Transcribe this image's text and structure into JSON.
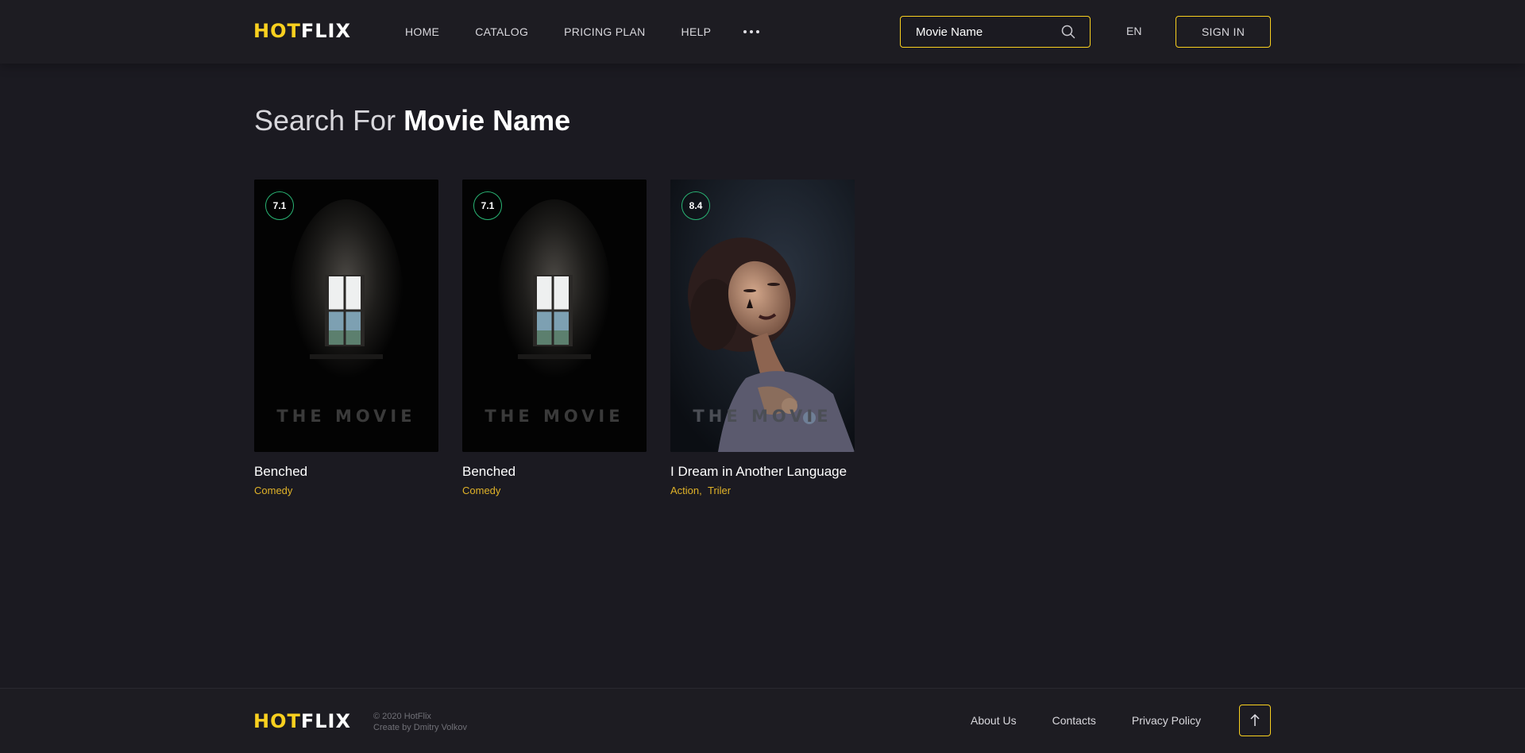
{
  "brand": {
    "hot": "HOT",
    "flix": "FLIX"
  },
  "nav": {
    "items": [
      "HOME",
      "CATALOG",
      "PRICING PLAN",
      "HELP"
    ]
  },
  "search": {
    "value": "Movie Name"
  },
  "header": {
    "lang": "EN",
    "signin": "SIGN IN"
  },
  "page": {
    "title_prefix": "Search For",
    "title_query": "Movie Name"
  },
  "results": [
    {
      "rating": "7.1",
      "title": "Benched",
      "poster_text": "THE MOVIE",
      "genres": [
        "Comedy"
      ]
    },
    {
      "rating": "7.1",
      "title": "Benched",
      "poster_text": "THE MOVIE",
      "genres": [
        "Comedy"
      ]
    },
    {
      "rating": "8.4",
      "title": "I Dream in Another Language",
      "poster_text": "THE MOVIE",
      "genres": [
        "Action",
        "Triler"
      ]
    }
  ],
  "footer": {
    "copyright": "© 2020 HotFlix",
    "credit": "Create by Dmitry Volkov",
    "links": [
      "About Us",
      "Contacts",
      "Privacy Policy"
    ]
  },
  "colors": {
    "accent": "#f9d01f",
    "genre": "#f9ab00",
    "rating_ring": "#29b474",
    "background": "#1b1a21"
  },
  "icons": {
    "search": "search-icon",
    "more": "more-icon",
    "scroll_up": "arrow-up-icon"
  }
}
